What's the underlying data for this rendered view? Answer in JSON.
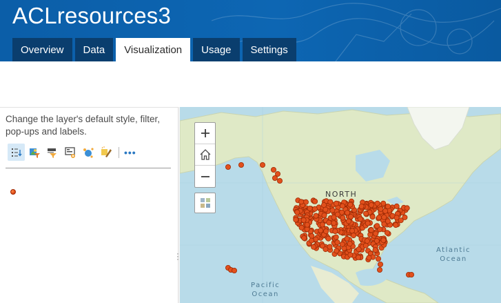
{
  "header": {
    "title": "ACLresources3",
    "tabs": [
      {
        "label": "Overview",
        "active": false
      },
      {
        "label": "Data",
        "active": false
      },
      {
        "label": "Visualization",
        "active": true
      },
      {
        "label": "Usage",
        "active": false
      },
      {
        "label": "Settings",
        "active": false
      }
    ]
  },
  "left_panel": {
    "description": "Change the layer's default style, filter, pop-ups and labels.",
    "tools": [
      "change-style-icon",
      "filter-icon",
      "configure-popup-icon",
      "labels-icon",
      "cluster-icon",
      "effects-icon"
    ],
    "more": "•••"
  },
  "map": {
    "labels": {
      "north": "NORTH",
      "atlantic": "Atlantic\nOcean",
      "pacific": "Pacific\nOcean"
    },
    "colors": {
      "water": "#b8dbe9",
      "land": "#dfe9c6",
      "point_fill": "#e2501c",
      "point_stroke": "#9c2a05"
    }
  }
}
